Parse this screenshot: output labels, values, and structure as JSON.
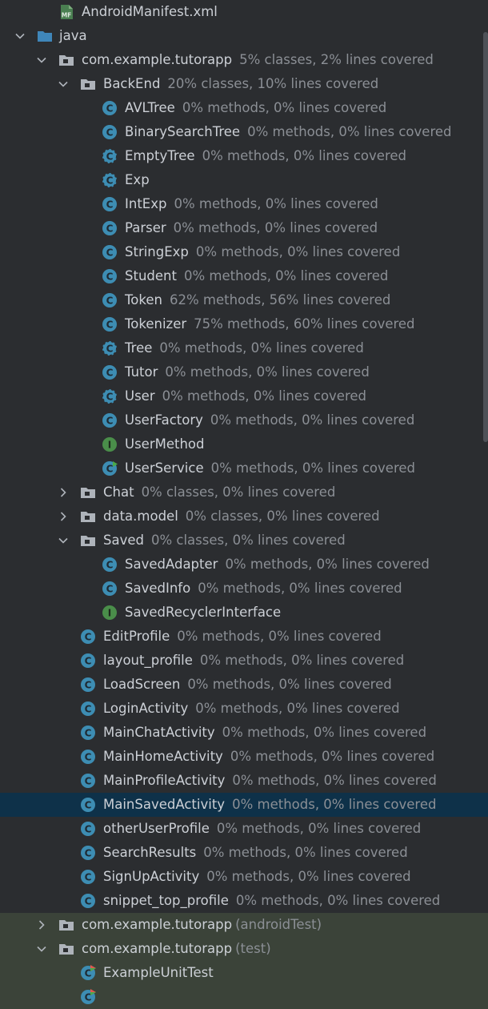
{
  "colors": {
    "background": "#2b2d30",
    "selected_row": "#0e3149",
    "test_area": "#3b4339",
    "class_icon": "#3d8db3",
    "interface_icon": "#4a8e4a",
    "folder_icon": "#aeb3ba",
    "java_folder": "#3f86b9",
    "text": "#ccd0d6",
    "stat_text": "#8b8f95"
  },
  "rows": [
    {
      "indent": 1,
      "arrow": "none",
      "icon": "manifest-icon",
      "name": "AndroidManifest.xml",
      "stat": ""
    },
    {
      "indent": 0,
      "arrow": "down",
      "icon": "java-folder-icon",
      "name": "java",
      "stat": ""
    },
    {
      "indent": 1,
      "arrow": "down",
      "icon": "package-icon",
      "name": "com.example.tutorapp",
      "stat": "5% classes, 2% lines covered"
    },
    {
      "indent": 2,
      "arrow": "down",
      "icon": "package-icon",
      "name": "BackEnd",
      "stat": "20% classes, 10% lines covered"
    },
    {
      "indent": 3,
      "arrow": "none",
      "icon": "class-icon",
      "name": "AVLTree",
      "stat": "0% methods, 0% lines covered"
    },
    {
      "indent": 3,
      "arrow": "none",
      "icon": "class-icon",
      "name": "BinarySearchTree",
      "stat": "0% methods, 0% lines covered"
    },
    {
      "indent": 3,
      "arrow": "none",
      "icon": "abstract-class-icon",
      "name": "EmptyTree",
      "stat": "0% methods, 0% lines covered"
    },
    {
      "indent": 3,
      "arrow": "none",
      "icon": "abstract-class-icon",
      "name": "Exp",
      "stat": ""
    },
    {
      "indent": 3,
      "arrow": "none",
      "icon": "class-icon",
      "name": "IntExp",
      "stat": "0% methods, 0% lines covered"
    },
    {
      "indent": 3,
      "arrow": "none",
      "icon": "class-icon",
      "name": "Parser",
      "stat": "0% methods, 0% lines covered"
    },
    {
      "indent": 3,
      "arrow": "none",
      "icon": "class-icon",
      "name": "StringExp",
      "stat": "0% methods, 0% lines covered"
    },
    {
      "indent": 3,
      "arrow": "none",
      "icon": "class-icon",
      "name": "Student",
      "stat": "0% methods, 0% lines covered"
    },
    {
      "indent": 3,
      "arrow": "none",
      "icon": "class-icon",
      "name": "Token",
      "stat": "62% methods, 56% lines covered"
    },
    {
      "indent": 3,
      "arrow": "none",
      "icon": "class-icon",
      "name": "Tokenizer",
      "stat": "75% methods, 60% lines covered"
    },
    {
      "indent": 3,
      "arrow": "none",
      "icon": "abstract-class-icon",
      "name": "Tree",
      "stat": "0% methods, 0% lines covered"
    },
    {
      "indent": 3,
      "arrow": "none",
      "icon": "class-icon",
      "name": "Tutor",
      "stat": "0% methods, 0% lines covered"
    },
    {
      "indent": 3,
      "arrow": "none",
      "icon": "abstract-class-icon",
      "name": "User",
      "stat": "0% methods, 0% lines covered"
    },
    {
      "indent": 3,
      "arrow": "none",
      "icon": "class-icon",
      "name": "UserFactory",
      "stat": "0% methods, 0% lines covered"
    },
    {
      "indent": 3,
      "arrow": "none",
      "icon": "interface-icon",
      "name": "UserMethod",
      "stat": ""
    },
    {
      "indent": 3,
      "arrow": "none",
      "icon": "service-class-icon",
      "name": "UserService",
      "stat": "0% methods, 0% lines covered"
    },
    {
      "indent": 2,
      "arrow": "right",
      "icon": "package-icon",
      "name": "Chat",
      "stat": "0% classes, 0% lines covered"
    },
    {
      "indent": 2,
      "arrow": "right",
      "icon": "package-icon",
      "name": "data.model",
      "stat": "0% classes, 0% lines covered"
    },
    {
      "indent": 2,
      "arrow": "down",
      "icon": "package-icon",
      "name": "Saved",
      "stat": "0% classes, 0% lines covered"
    },
    {
      "indent": 3,
      "arrow": "none",
      "icon": "class-icon",
      "name": "SavedAdapter",
      "stat": "0% methods, 0% lines covered"
    },
    {
      "indent": 3,
      "arrow": "none",
      "icon": "class-icon",
      "name": "SavedInfo",
      "stat": "0% methods, 0% lines covered"
    },
    {
      "indent": 3,
      "arrow": "none",
      "icon": "interface-icon",
      "name": "SavedRecyclerInterface",
      "stat": ""
    },
    {
      "indent": 2,
      "arrow": "none",
      "icon": "class-icon",
      "name": "EditProfile",
      "stat": "0% methods, 0% lines covered"
    },
    {
      "indent": 2,
      "arrow": "none",
      "icon": "class-icon",
      "name": "layout_profile",
      "stat": "0% methods, 0% lines covered"
    },
    {
      "indent": 2,
      "arrow": "none",
      "icon": "class-icon",
      "name": "LoadScreen",
      "stat": "0% methods, 0% lines covered"
    },
    {
      "indent": 2,
      "arrow": "none",
      "icon": "class-icon",
      "name": "LoginActivity",
      "stat": "0% methods, 0% lines covered"
    },
    {
      "indent": 2,
      "arrow": "none",
      "icon": "class-icon",
      "name": "MainChatActivity",
      "stat": "0% methods, 0% lines covered"
    },
    {
      "indent": 2,
      "arrow": "none",
      "icon": "class-icon",
      "name": "MainHomeActivity",
      "stat": "0% methods, 0% lines covered"
    },
    {
      "indent": 2,
      "arrow": "none",
      "icon": "class-icon",
      "name": "MainProfileActivity",
      "stat": "0% methods, 0% lines covered"
    },
    {
      "indent": 2,
      "arrow": "none",
      "icon": "class-icon",
      "name": "MainSavedActivity",
      "stat": "0% methods, 0% lines covered",
      "selected": true
    },
    {
      "indent": 2,
      "arrow": "none",
      "icon": "class-icon",
      "name": "otherUserProfile",
      "stat": "0% methods, 0% lines covered"
    },
    {
      "indent": 2,
      "arrow": "none",
      "icon": "class-icon",
      "name": "SearchResults",
      "stat": "0% methods, 0% lines covered"
    },
    {
      "indent": 2,
      "arrow": "none",
      "icon": "class-icon",
      "name": "SignUpActivity",
      "stat": "0% methods, 0% lines covered"
    },
    {
      "indent": 2,
      "arrow": "none",
      "icon": "class-icon",
      "name": "snippet_top_profile",
      "stat": "0% methods, 0% lines covered"
    },
    {
      "indent": 1,
      "arrow": "right",
      "icon": "package-icon",
      "name": "com.example.tutorapp",
      "paren": "(androidTest)",
      "test": true
    },
    {
      "indent": 1,
      "arrow": "down",
      "icon": "package-icon",
      "name": "com.example.tutorapp",
      "paren": "(test)",
      "test": true
    },
    {
      "indent": 2,
      "arrow": "none",
      "icon": "test-class-icon",
      "name": "ExampleUnitTest",
      "stat": "",
      "test": true
    },
    {
      "indent": 2,
      "arrow": "none",
      "icon": "test-class-icon",
      "name": "",
      "stat": "",
      "test": true
    }
  ]
}
